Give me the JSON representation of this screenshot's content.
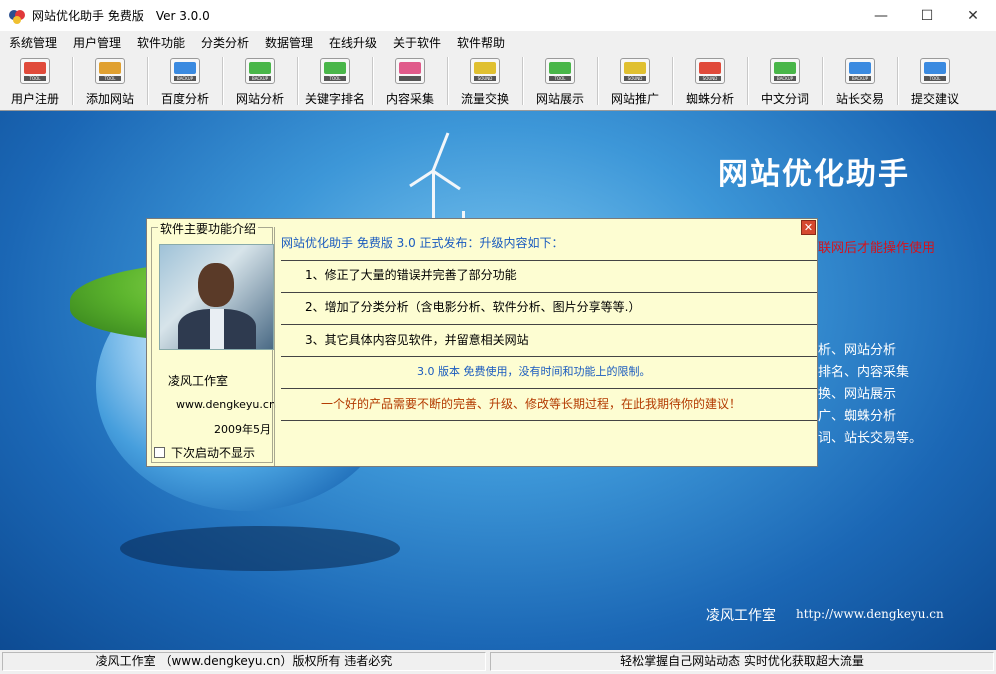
{
  "window": {
    "title": "网站优化助手 免费版　Ver  3.0.0",
    "controls": [
      "—",
      "☐",
      "✕"
    ]
  },
  "menu": [
    "系统管理",
    "用户管理",
    "软件功能",
    "分类分析",
    "数据管理",
    "在线升级",
    "关于软件",
    "软件帮助"
  ],
  "toolbar": [
    {
      "label": "用户注册",
      "icon": "tool-icon",
      "badge": "TOOL",
      "color": "#e04a3a"
    },
    {
      "label": "添加网站",
      "icon": "tool-icon",
      "badge": "TOOL",
      "color": "#e0a030"
    },
    {
      "label": "百度分析",
      "icon": "backup-icon",
      "badge": "BACKUP",
      "color": "#3a8ae0"
    },
    {
      "label": "网站分析",
      "icon": "backup-icon",
      "badge": "BACKUP",
      "color": "#49b649"
    },
    {
      "label": "关键字排名",
      "icon": "tool-icon",
      "badge": "TOOL",
      "color": "#49b649"
    },
    {
      "label": "内容采集",
      "icon": "gift-icon",
      "badge": "",
      "color": "#e05a8a"
    },
    {
      "label": "流量交换",
      "icon": "sound-icon",
      "badge": "SOUND",
      "color": "#e0c030"
    },
    {
      "label": "网站展示",
      "icon": "tool-icon",
      "badge": "TOOL",
      "color": "#49b649"
    },
    {
      "label": "网站推广",
      "icon": "sound-icon",
      "badge": "SOUND",
      "color": "#e0c030"
    },
    {
      "label": "蜘蛛分析",
      "icon": "music-icon",
      "badge": "SOUND",
      "color": "#e04a3a"
    },
    {
      "label": "中文分词",
      "icon": "backup-icon",
      "badge": "BACKUP",
      "color": "#49b649"
    },
    {
      "label": "站长交易",
      "icon": "backup-icon",
      "badge": "BACKUP",
      "color": "#3a8ae0"
    },
    {
      "label": "提交建议",
      "icon": "tool-icon",
      "badge": "TOOL",
      "color": "#3a8ae0"
    }
  ],
  "banner": {
    "title": "网站优化助手",
    "red_note": "联网后才能操作使用",
    "features": [
      "析、网站分析",
      "排名、内容采集",
      "换、网站展示",
      "广、蜘蛛分析",
      "词、站长交易等。"
    ],
    "studio": "凌风工作室",
    "url": "http://www.dengkeyu.cn"
  },
  "dialog": {
    "group_title": "软件主要功能介绍",
    "studio_name": "凌风工作室",
    "studio_url": "www.dengkeyu.cn",
    "studio_date": "2009年5月",
    "checkbox_label": "下次启动不显示",
    "release_title": "网站优化助手 免费版 3.0 正式发布：升级内容如下：",
    "items": [
      "1、修正了大量的错误并完善了部分功能",
      "2、增加了分类分析（含电影分析、软件分析、图片分享等等.）",
      "3、其它具体内容见软件，并留意相关网站"
    ],
    "free_note": "3.0 版本 免费使用，没有时间和功能上的限制。",
    "suggestion": "一个好的产品需要不断的完善、升级、修改等长期过程，在此我期待你的建议！",
    "close_glyph": "✕"
  },
  "status": {
    "left": "凌风工作室 （www.dengkeyu.cn）版权所有 违者必究",
    "right": "轻松掌握自己网站动态  实时优化获取超大流量"
  }
}
